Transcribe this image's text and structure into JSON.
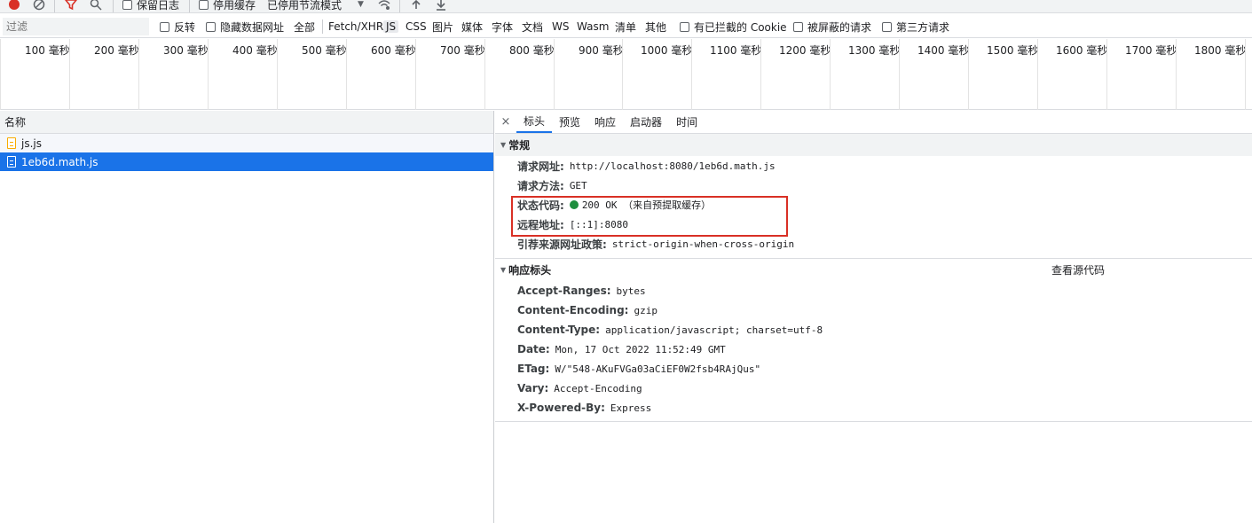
{
  "toolbar": {
    "preserve_log_label": "保留日志",
    "disable_cache_label": "停用缓存",
    "throttling_value": "已停用节流模式",
    "icons": [
      "record-icon",
      "clear-icon",
      "filter-icon",
      "search-icon",
      "network-conditions-icon",
      "import-icon",
      "export-icon"
    ]
  },
  "filterbar": {
    "placeholder": "过滤",
    "invert_label": "反转",
    "hide_data_urls_label": "隐藏数据网址",
    "types": [
      "全部",
      "Fetch/XHR",
      "JS",
      "CSS",
      "图片",
      "媒体",
      "字体",
      "文档",
      "WS",
      "Wasm",
      "清单",
      "其他"
    ],
    "active_type": "JS",
    "blocked_cookies_label": "有已拦截的 Cookie",
    "blocked_requests_label": "被屏蔽的请求",
    "third_party_label": "第三方请求"
  },
  "timeline": {
    "ticks": [
      "100 毫秒",
      "200 毫秒",
      "300 毫秒",
      "400 毫秒",
      "500 毫秒",
      "600 毫秒",
      "700 毫秒",
      "800 毫秒",
      "900 毫秒",
      "1000 毫秒",
      "1100 毫秒",
      "1200 毫秒",
      "1300 毫秒",
      "1400 毫秒",
      "1500 毫秒",
      "1600 毫秒",
      "1700 毫秒",
      "1800 毫秒"
    ]
  },
  "requests": {
    "header": "名称",
    "items": [
      {
        "name": "js.js",
        "selected": false
      },
      {
        "name": "1eb6d.math.js",
        "selected": true
      }
    ]
  },
  "details": {
    "close": "×",
    "tabs": [
      "标头",
      "预览",
      "响应",
      "启动器",
      "时间"
    ],
    "active_tab": "标头",
    "general": {
      "title": "常规",
      "request_url_k": "请求网址:",
      "request_url_v": "http://localhost:8080/1eb6d.math.js",
      "method_k": "请求方法:",
      "method_v": "GET",
      "status_k": "状态代码:",
      "status_v": "200 OK （来自预提取缓存）",
      "status_color": "#1e8e3e",
      "remote_k": "远程地址:",
      "remote_v": "[::1]:8080",
      "referrer_k": "引荐来源网址政策:",
      "referrer_v": "strict-origin-when-cross-origin"
    },
    "response_headers": {
      "title": "响应标头",
      "view_source": "查看源代码",
      "rows": [
        {
          "k": "Accept-Ranges:",
          "v": "bytes"
        },
        {
          "k": "Content-Encoding:",
          "v": "gzip"
        },
        {
          "k": "Content-Type:",
          "v": "application/javascript; charset=utf-8"
        },
        {
          "k": "Date:",
          "v": "Mon, 17 Oct 2022 11:52:49 GMT"
        },
        {
          "k": "ETag:",
          "v": "W/\"548-AKuFVGa03aCiEF0W2fsb4RAjQus\""
        },
        {
          "k": "Vary:",
          "v": "Accept-Encoding"
        },
        {
          "k": "X-Powered-By:",
          "v": "Express"
        }
      ]
    }
  },
  "colors": {
    "accent": "#1a73e8",
    "highlight_box": "#d93025"
  }
}
